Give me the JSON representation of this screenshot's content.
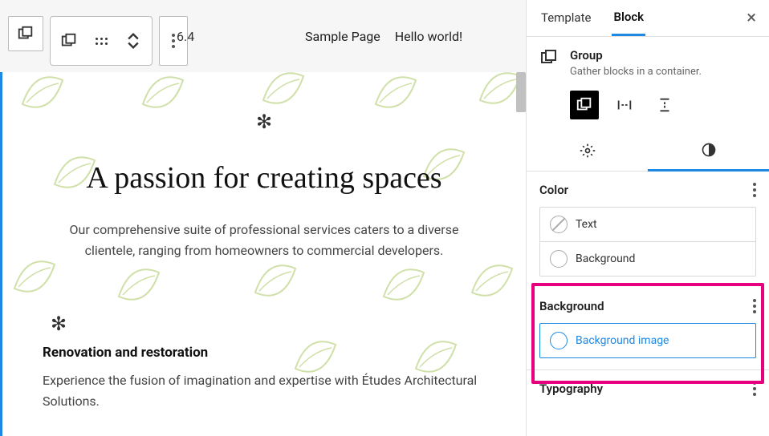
{
  "editor": {
    "version": "6.4",
    "nav": [
      "Sample Page",
      "Hello world!"
    ]
  },
  "document": {
    "heading": "A passion for creating spaces",
    "lead": "Our comprehensive suite of professional services caters to a diverse clientele, ranging from homeowners to commercial developers.",
    "sub_heading": "Renovation and restoration",
    "sub_text": "Experience the fusion of imagination and expertise with Études Architectural Solutions."
  },
  "sidebar": {
    "tabs": {
      "template": "Template",
      "block": "Block"
    },
    "block": {
      "name": "Group",
      "description": "Gather blocks in a container."
    },
    "color": {
      "label": "Color",
      "text": "Text",
      "background": "Background"
    },
    "background": {
      "label": "Background",
      "image": "Background image"
    },
    "typography": {
      "label": "Typography"
    }
  }
}
